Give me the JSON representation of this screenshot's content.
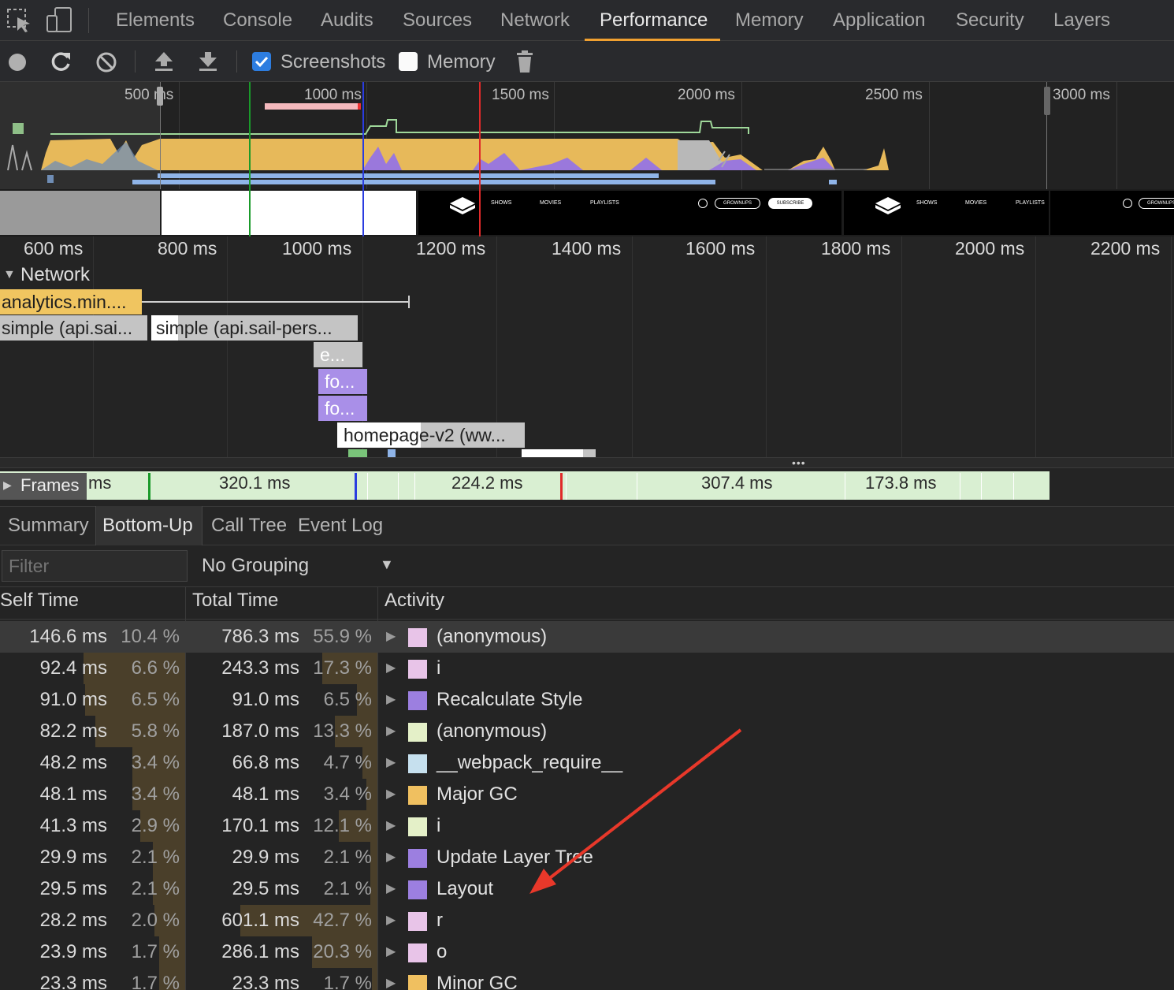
{
  "tabs": [
    {
      "label": "Elements"
    },
    {
      "label": "Console"
    },
    {
      "label": "Audits"
    },
    {
      "label": "Sources"
    },
    {
      "label": "Network"
    },
    {
      "label": "Performance"
    },
    {
      "label": "Memory"
    },
    {
      "label": "Application"
    },
    {
      "label": "Security"
    },
    {
      "label": "Layers"
    }
  ],
  "toolbar": {
    "screenshots_label": "Screenshots",
    "screenshots_checked": true,
    "memory_label": "Memory",
    "memory_checked": false
  },
  "overview": {
    "labels": [
      "500 ms",
      "1000 ms",
      "1500 ms",
      "2000 ms",
      "2500 ms",
      "3000 ms"
    ],
    "filmstrip": {
      "nav_items": [
        "SHOWS",
        "MOVIES",
        "PLAYLISTS"
      ],
      "buttons": [
        "GROWNUPS",
        "SUBSCRIBE"
      ]
    }
  },
  "ruler": {
    "labels": [
      "600 ms",
      "800 ms",
      "1000 ms",
      "1200 ms",
      "1400 ms",
      "1600 ms",
      "1800 ms",
      "2000 ms",
      "2200 ms"
    ]
  },
  "network": {
    "title": "Network",
    "requests": [
      {
        "label": "analytics.min...."
      },
      {
        "label": "simple (api.sai..."
      },
      {
        "label": "simple (api.sail-pers..."
      },
      {
        "label": "e..."
      },
      {
        "label": "fo..."
      },
      {
        "label": "fo..."
      },
      {
        "label": "homepage-v2 (ww..."
      }
    ]
  },
  "frames": {
    "title": "Frames",
    "first_partial": "ms",
    "durations": [
      "320.1 ms",
      "224.2 ms",
      "307.4 ms",
      "173.8 ms"
    ]
  },
  "bottom_tabs": [
    {
      "label": "Summary"
    },
    {
      "label": "Bottom-Up"
    },
    {
      "label": "Call Tree"
    },
    {
      "label": "Event Log"
    }
  ],
  "filter": {
    "placeholder": "Filter"
  },
  "grouping": {
    "value": "No Grouping"
  },
  "table": {
    "headers": {
      "self": "Self Time",
      "total": "Total Time",
      "activity": "Activity"
    },
    "rows": [
      {
        "self_time": "146.6 ms",
        "self_pct": "10.4 %",
        "total_time": "786.3 ms",
        "total_pct": "55.9 %",
        "activity": "(anonymous)",
        "color": "#e8c4e8",
        "self_frac": 0.104,
        "total_frac": 0.559
      },
      {
        "self_time": "92.4 ms",
        "self_pct": "6.6 %",
        "total_time": "243.3 ms",
        "total_pct": "17.3 %",
        "activity": "i",
        "color": "#e8c4e8",
        "self_frac": 0.066,
        "total_frac": 0.173
      },
      {
        "self_time": "91.0 ms",
        "self_pct": "6.5 %",
        "total_time": "91.0 ms",
        "total_pct": "6.5 %",
        "activity": "Recalculate Style",
        "color": "#9c7fe0",
        "self_frac": 0.065,
        "total_frac": 0.065
      },
      {
        "self_time": "82.2 ms",
        "self_pct": "5.8 %",
        "total_time": "187.0 ms",
        "total_pct": "13.3 %",
        "activity": "(anonymous)",
        "color": "#e4f0c8",
        "self_frac": 0.058,
        "total_frac": 0.133
      },
      {
        "self_time": "48.2 ms",
        "self_pct": "3.4 %",
        "total_time": "66.8 ms",
        "total_pct": "4.7 %",
        "activity": "__webpack_require__",
        "color": "#c6e0ee",
        "self_frac": 0.034,
        "total_frac": 0.047
      },
      {
        "self_time": "48.1 ms",
        "self_pct": "3.4 %",
        "total_time": "48.1 ms",
        "total_pct": "3.4 %",
        "activity": "Major GC",
        "color": "#f0c060",
        "self_frac": 0.034,
        "total_frac": 0.034
      },
      {
        "self_time": "41.3 ms",
        "self_pct": "2.9 %",
        "total_time": "170.1 ms",
        "total_pct": "12.1 %",
        "activity": "i",
        "color": "#e4f0c8",
        "self_frac": 0.029,
        "total_frac": 0.121
      },
      {
        "self_time": "29.9 ms",
        "self_pct": "2.1 %",
        "total_time": "29.9 ms",
        "total_pct": "2.1 %",
        "activity": "Update Layer Tree",
        "color": "#9c7fe0",
        "self_frac": 0.021,
        "total_frac": 0.021
      },
      {
        "self_time": "29.5 ms",
        "self_pct": "2.1 %",
        "total_time": "29.5 ms",
        "total_pct": "2.1 %",
        "activity": "Layout",
        "color": "#9c7fe0",
        "self_frac": 0.021,
        "total_frac": 0.021
      },
      {
        "self_time": "28.2 ms",
        "self_pct": "2.0 %",
        "total_time": "601.1 ms",
        "total_pct": "42.7 %",
        "activity": "r",
        "color": "#e8c4e8",
        "self_frac": 0.02,
        "total_frac": 0.427
      },
      {
        "self_time": "23.9 ms",
        "self_pct": "1.7 %",
        "total_time": "286.1 ms",
        "total_pct": "20.3 %",
        "activity": "o",
        "color": "#e8c4e8",
        "self_frac": 0.017,
        "total_frac": 0.203
      },
      {
        "self_time": "23.3 ms",
        "self_pct": "1.7 %",
        "total_time": "23.3 ms",
        "total_pct": "1.7 %",
        "activity": "Minor GC",
        "color": "#f0c060",
        "self_frac": 0.017,
        "total_frac": 0.017
      }
    ]
  }
}
